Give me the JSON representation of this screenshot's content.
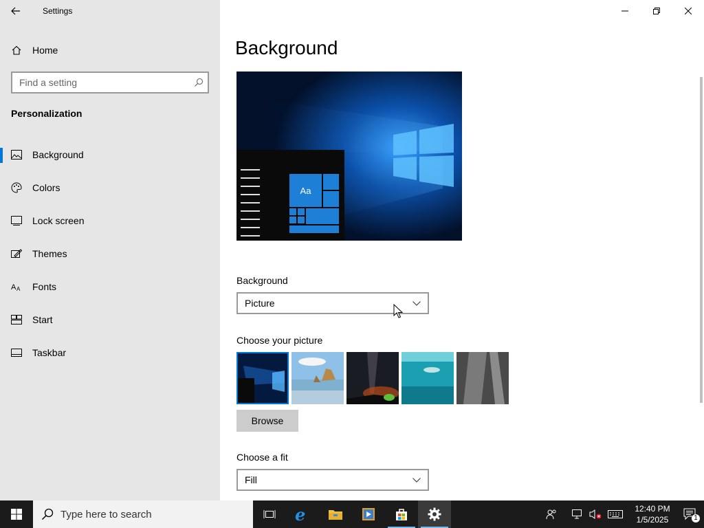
{
  "window": {
    "title": "Settings",
    "back_icon": "back-arrow-icon",
    "controls": [
      "minimize-icon",
      "restore-icon",
      "close-icon"
    ]
  },
  "sidebar": {
    "home_label": "Home",
    "search_placeholder": "Find a setting",
    "section_title": "Personalization",
    "items": [
      {
        "label": "Background",
        "icon": "picture-icon",
        "active": true
      },
      {
        "label": "Colors",
        "icon": "palette-icon",
        "active": false
      },
      {
        "label": "Lock screen",
        "icon": "lock-screen-icon",
        "active": false
      },
      {
        "label": "Themes",
        "icon": "themes-icon",
        "active": false
      },
      {
        "label": "Fonts",
        "icon": "fonts-icon",
        "active": false
      },
      {
        "label": "Start",
        "icon": "start-icon",
        "active": false
      },
      {
        "label": "Taskbar",
        "icon": "taskbar-icon",
        "active": false
      }
    ]
  },
  "main": {
    "title": "Background",
    "preview_tile_label": "Aa",
    "background_label": "Background",
    "background_value": "Picture",
    "choose_picture_label": "Choose your picture",
    "browse_label": "Browse",
    "choose_fit_label": "Choose a fit",
    "fit_value": "Fill"
  },
  "taskbar": {
    "search_placeholder": "Type here to search",
    "apps": [
      "task-view-icon",
      "edge-icon",
      "file-explorer-icon",
      "media-player-icon",
      "store-icon",
      "settings-icon"
    ],
    "clock_time": "12:40 PM",
    "clock_date": "1/5/2025",
    "notification_count": "1"
  },
  "colors": {
    "accent": "#0078d7",
    "sidebar_bg": "#e6e6e6",
    "taskbar_bg": "#1b1b1b"
  }
}
